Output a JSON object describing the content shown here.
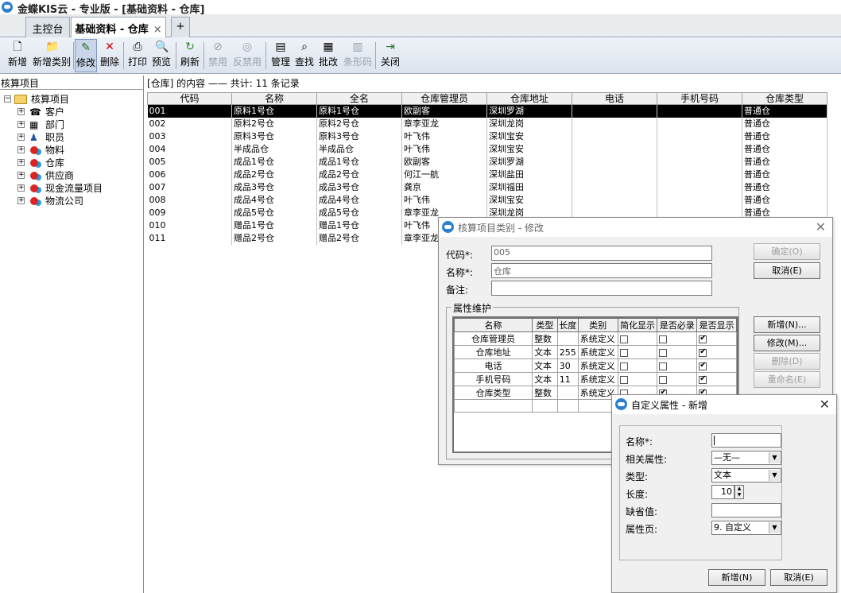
{
  "window": {
    "title": "金蝶KIS云 - 专业版 - [基础资料 - 仓库]"
  },
  "tabs": [
    {
      "label": "主控台"
    },
    {
      "label": "基础资料 - 仓库",
      "close": "×"
    }
  ],
  "tab_add": "+",
  "toolbar": {
    "items": [
      {
        "label": "新增",
        "icon": "new-document-icon",
        "glyph": "🗋"
      },
      {
        "label": "新增类别",
        "icon": "folder-icon",
        "glyph": "📁"
      },
      {
        "label": "修改",
        "icon": "edit-icon",
        "glyph": "✎"
      },
      {
        "label": "删除",
        "icon": "delete-icon",
        "glyph": "✕"
      },
      {
        "label": "打印",
        "icon": "printer-icon",
        "glyph": "⎙"
      },
      {
        "label": "预览",
        "icon": "preview-icon",
        "glyph": "🔍"
      },
      {
        "label": "刷新",
        "icon": "refresh-icon",
        "glyph": "↻"
      },
      {
        "label": "禁用",
        "icon": "disable-icon",
        "glyph": "⊘"
      },
      {
        "label": "反禁用",
        "icon": "enable-icon",
        "glyph": "◎"
      },
      {
        "label": "管理",
        "icon": "manage-icon",
        "glyph": "▤"
      },
      {
        "label": "查找",
        "icon": "find-icon",
        "glyph": "⌕"
      },
      {
        "label": "批改",
        "icon": "batch-edit-icon",
        "glyph": "▦"
      },
      {
        "label": "条形码",
        "icon": "barcode-icon",
        "glyph": "▥"
      },
      {
        "label": "关闭",
        "icon": "exit-icon",
        "glyph": "⇥"
      }
    ]
  },
  "left_panel": {
    "title": "核算项目",
    "root": "核算项目",
    "items": [
      "客户",
      "部门",
      "职员",
      "物料",
      "仓库",
      "供应商",
      "现金流量项目",
      "物流公司"
    ]
  },
  "main": {
    "heading": "[仓库] 的内容 —— 共计: 11 条记录",
    "columns": [
      "代码",
      "名称",
      "全名",
      "仓库管理员",
      "仓库地址",
      "电话",
      "手机号码",
      "仓库类型"
    ],
    "rows": [
      [
        "001",
        "原料1号仓",
        "原料1号仓",
        "欧副客",
        "深圳罗湖",
        "",
        "",
        "普通仓"
      ],
      [
        "002",
        "原料2号仓",
        "原料2号仓",
        "章李亚龙",
        "深圳龙岗",
        "",
        "",
        "普通仓"
      ],
      [
        "003",
        "原料3号仓",
        "原料3号仓",
        "叶飞伟",
        "深圳宝安",
        "",
        "",
        "普通仓"
      ],
      [
        "004",
        "半成品仓",
        "半成品仓",
        "叶飞伟",
        "深圳宝安",
        "",
        "",
        "普通仓"
      ],
      [
        "005",
        "成品1号仓",
        "成品1号仓",
        "欧副客",
        "深圳罗湖",
        "",
        "",
        "普通仓"
      ],
      [
        "006",
        "成品2号仓",
        "成品2号仓",
        "何江一航",
        "深圳盐田",
        "",
        "",
        "普通仓"
      ],
      [
        "007",
        "成品3号仓",
        "成品3号仓",
        "龚京",
        "深圳福田",
        "",
        "",
        "普通仓"
      ],
      [
        "008",
        "成品4号仓",
        "成品4号仓",
        "叶飞伟",
        "深圳宝安",
        "",
        "",
        "普通仓"
      ],
      [
        "009",
        "成品5号仓",
        "成品5号仓",
        "章李亚龙",
        "深圳龙岗",
        "",
        "",
        "普通仓"
      ],
      [
        "010",
        "赠品1号仓",
        "赠品1号仓",
        "叶飞伟",
        "",
        "",
        "",
        ""
      ],
      [
        "011",
        "赠品2号仓",
        "赠品2号仓",
        "章李亚龙",
        "",
        "",
        "",
        ""
      ]
    ]
  },
  "dialog_category": {
    "title": "核算项目类别 - 修改",
    "close": "✕",
    "code_label": "代码*:",
    "code_value": "005",
    "name_label": "名称*:",
    "name_value": "仓库",
    "note_label": "备注:",
    "note_value": "",
    "ok": "确定(O)",
    "cancel": "取消(E)",
    "group_label": "属性维护",
    "attr_columns": [
      "名称",
      "类型",
      "长度",
      "类别",
      "简化显示",
      "是否必录",
      "是否显示"
    ],
    "attr_rows": [
      {
        "name": "仓库管理员",
        "type": "整数",
        "length": "",
        "category": "系统定义",
        "simplified": false,
        "required": false,
        "visible": true
      },
      {
        "name": "仓库地址",
        "type": "文本",
        "length": "255",
        "category": "系统定义",
        "simplified": false,
        "required": false,
        "visible": true
      },
      {
        "name": "电话",
        "type": "文本",
        "length": "30",
        "category": "系统定义",
        "simplified": false,
        "required": false,
        "visible": true
      },
      {
        "name": "手机号码",
        "type": "文本",
        "length": "11",
        "category": "系统定义",
        "simplified": false,
        "required": false,
        "visible": true
      },
      {
        "name": "仓库类型",
        "type": "整数",
        "length": "",
        "category": "系统定义",
        "simplified": false,
        "required": true,
        "visible": true
      }
    ],
    "add": "新增(N)...",
    "modify": "修改(M)...",
    "delete": "删除(D)",
    "rename": "重命名(E)"
  },
  "dialog_custom": {
    "title": "自定义属性 - 新增",
    "close": "✕",
    "name_label": "名称*:",
    "name_value": "",
    "related_label": "相关属性:",
    "related_value": "—无—",
    "type_label": "类型:",
    "type_value": "文本",
    "length_label": "长度:",
    "length_value": "10",
    "default_label": "缺省值:",
    "default_value": "",
    "page_label": "属性页:",
    "page_value": "9. 自定义",
    "add": "新增(N)",
    "cancel": "取消(E)"
  }
}
